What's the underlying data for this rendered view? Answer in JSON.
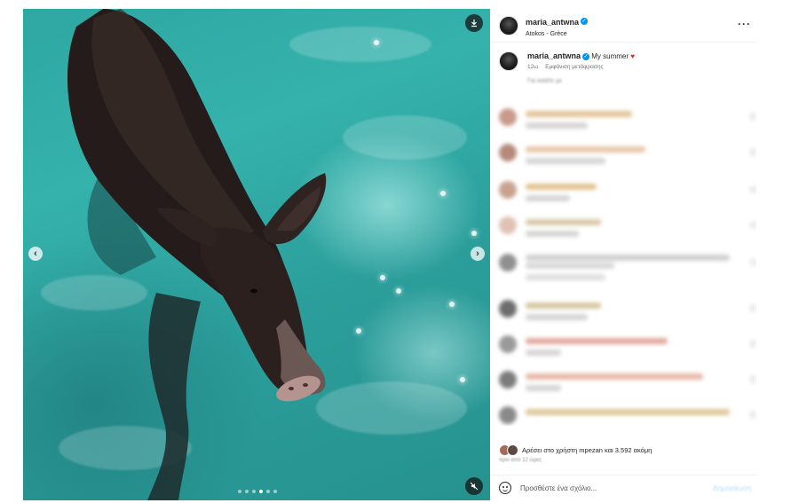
{
  "post": {
    "username": "maria_antwna",
    "location": "Atokos - Grèce",
    "caption": "My summer",
    "caption_age": "12ω",
    "translation_label": "Εμφάνιση μετάφρασης",
    "blurred_line": "Για καιάτε με"
  },
  "likes": {
    "text": "Αρέσει στο χρήστη mpezan και 3.592 ακόμη",
    "time": "πριν από 12 ώρες"
  },
  "composer": {
    "placeholder": "Προσθέστε ένα σχόλιο...",
    "post_label": "Δημοσίευση"
  },
  "media": {
    "carousel_dots": 6,
    "active_dot": 3
  },
  "icons": [
    "download-icon",
    "more-options-icon",
    "verified-badge-icon",
    "previous-arrow-icon",
    "next-arrow-icon",
    "mute-icon",
    "emoji-icon",
    "heart-icon"
  ]
}
